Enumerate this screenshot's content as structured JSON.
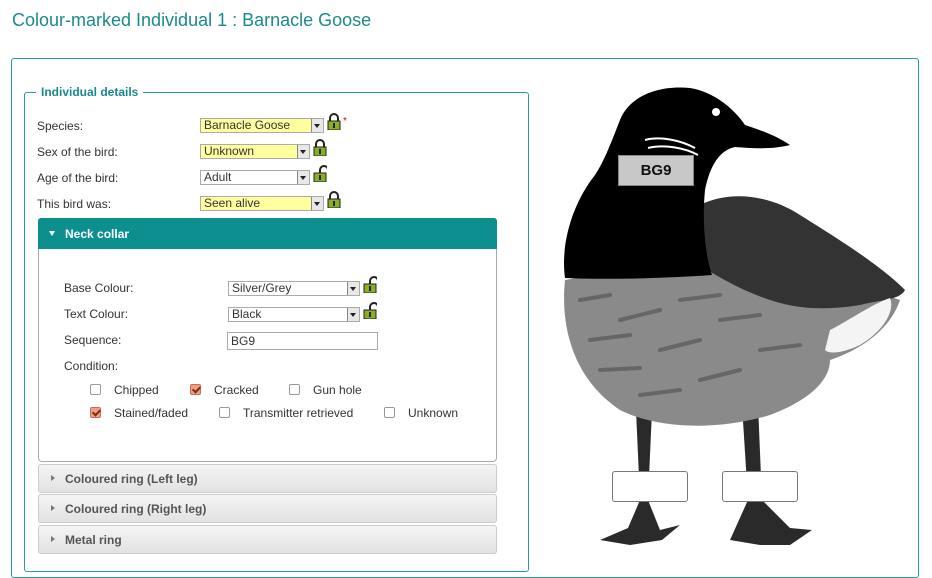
{
  "page": {
    "title": "Colour-marked Individual 1 : Barnacle Goose"
  },
  "individual": {
    "legend": "Individual details",
    "fields": [
      {
        "label": "Species:",
        "value": "Barnacle Goose"
      },
      {
        "label": "Sex of the bird:",
        "value": "Unknown"
      },
      {
        "label": "Age of the bird:",
        "value": "Adult"
      },
      {
        "label": "This bird was:",
        "value": "Seen alive"
      }
    ],
    "required_mark": "*"
  },
  "neck_collar": {
    "title": "Neck collar",
    "base_colour_label": "Base Colour:",
    "base_colour_value": "Silver/Grey",
    "text_colour_label": "Text Colour:",
    "text_colour_value": "Black",
    "sequence_label": "Sequence:",
    "sequence_value": "BG9",
    "condition_label": "Condition:",
    "conditions": [
      {
        "label": "Chipped",
        "checked": false
      },
      {
        "label": "Cracked",
        "checked": true
      },
      {
        "label": "Gun hole",
        "checked": false
      },
      {
        "label": "Stained/faded",
        "checked": true
      },
      {
        "label": "Transmitter retrieved",
        "checked": false
      },
      {
        "label": "Unknown",
        "checked": false
      }
    ]
  },
  "sections": [
    {
      "title": "Coloured ring (Left leg)"
    },
    {
      "title": "Coloured ring (Right leg)"
    },
    {
      "title": "Metal ring"
    }
  ],
  "bird_image": {
    "collar_text": "BG9"
  },
  "colors": {
    "accent": "#0e8f8f",
    "highlight": "#ffffa0",
    "checked": "#f0a080"
  }
}
